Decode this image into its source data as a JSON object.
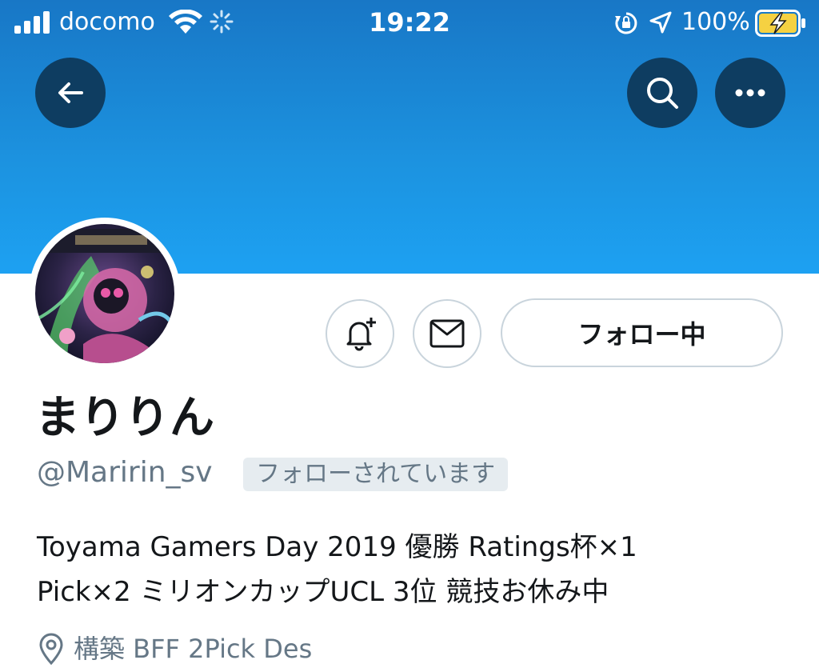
{
  "status_bar": {
    "carrier": "docomo",
    "time": "19:22",
    "battery_percent": "100%",
    "signal_bars": 4,
    "icons": [
      "signal-icon",
      "wifi-icon",
      "loading-spinner-icon",
      "rotation-lock-icon",
      "location-arrow-icon",
      "battery-charging-icon"
    ]
  },
  "header": {
    "banner_color": "#1da1f2",
    "buttons": {
      "back": "back-arrow-icon",
      "search": "search-icon",
      "more": "more-dots-icon"
    },
    "button_color": "#0e3d61"
  },
  "profile": {
    "display_name": "まりりん",
    "handle": "@Maririn_sv",
    "follows_you_badge": "フォローされています",
    "bio_line1": "Toyama Gamers Day 2019 優勝 Ratings杯×1",
    "bio_line2": "Pick×2 ミリオンカップUCL 3位 競技お休み中",
    "location": "構築 BFF 2Pick Des"
  },
  "actions": {
    "notify_icon": "bell-plus-icon",
    "message_icon": "envelope-icon",
    "following_label": "フォロー中"
  },
  "colors": {
    "text_primary": "#14171a",
    "text_secondary": "#657786",
    "border": "#c9d4dc",
    "badge_bg": "#e6ecf0"
  }
}
